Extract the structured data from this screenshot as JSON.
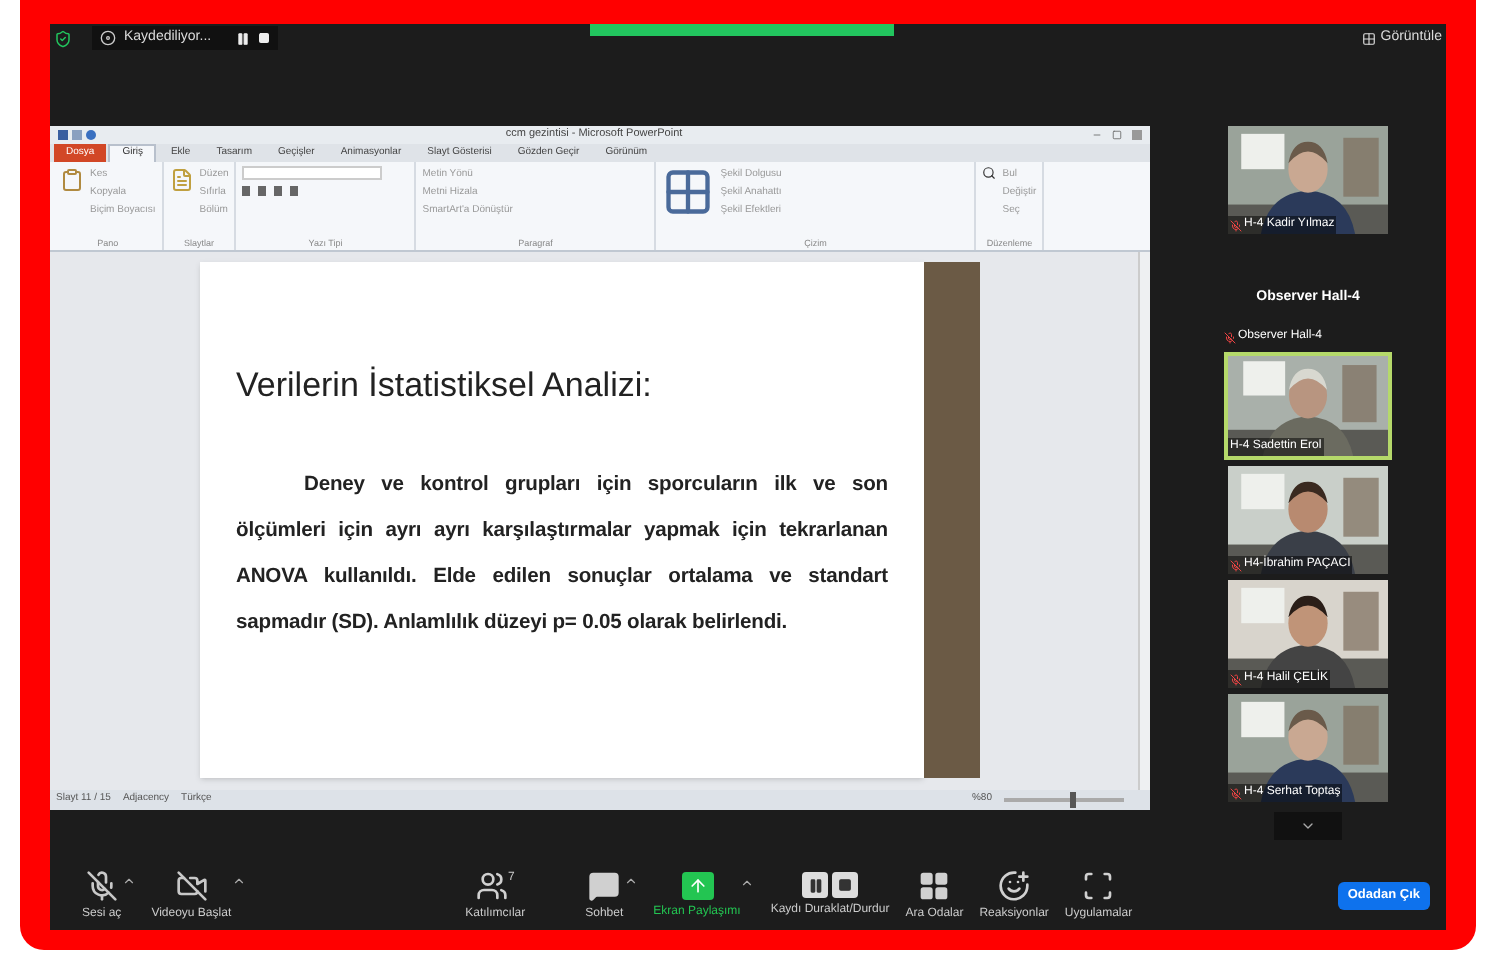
{
  "top_bar": {
    "recording_label": "Kaydediliyor...",
    "view_button": "Görüntüle"
  },
  "powerpoint": {
    "title": "ccm gezintisi - Microsoft PowerPoint",
    "tabs": [
      {
        "label": "Dosya",
        "selected": false,
        "kind": "file"
      },
      {
        "label": "Giriş",
        "selected": true,
        "kind": "tab"
      },
      {
        "label": "Ekle",
        "selected": false,
        "kind": "tab"
      },
      {
        "label": "Tasarım",
        "selected": false,
        "kind": "tab"
      },
      {
        "label": "Geçişler",
        "selected": false,
        "kind": "tab"
      },
      {
        "label": "Animasyonlar",
        "selected": false,
        "kind": "tab"
      },
      {
        "label": "Slayt Gösterisi",
        "selected": false,
        "kind": "tab"
      },
      {
        "label": "Gözden Geçir",
        "selected": false,
        "kind": "tab"
      },
      {
        "label": "Görünüm",
        "selected": false,
        "kind": "tab"
      }
    ],
    "ribbon_groups": [
      {
        "label": "Pano",
        "buttons": [
          "Kes",
          "Kopyala",
          "Biçim Boyacısı"
        ]
      },
      {
        "label": "Slaytlar",
        "buttons": [
          "Düzen",
          "Sıfırla",
          "Bölüm"
        ]
      },
      {
        "label": "Yazı Tipi"
      },
      {
        "label": "Paragraf",
        "buttons": [
          "Metin Yönü",
          "Metni Hizala",
          "SmartArt'a Dönüştür"
        ]
      },
      {
        "label": "Çizim",
        "buttons": [
          "Şekil Dolgusu",
          "Şekil Anahattı",
          "Şekil Efektleri"
        ]
      },
      {
        "label": "Düzenleme",
        "buttons": [
          "Bul",
          "Değiştir",
          "Seç"
        ]
      }
    ],
    "slide": {
      "title": "Verilerin İstatistiksel Analizi:",
      "paragraph": "Deney ve kontrol grupları için sporcuların ilk ve son ölçümleri için ayrı ayrı karşılaştırmalar yapmak için tekrarlanan ANOVA kullanıldı. Elde edilen sonuçlar ortalama ve standart sapmadır (SD). Anlamlılık düzeyi p= 0.05 olarak belirlendi."
    },
    "status_bar": [
      "Slayt 11 / 15",
      "Adjacency",
      "Türkçe"
    ],
    "zoom": {
      "reading": "%80",
      "level": 0.55
    }
  },
  "participants": [
    {
      "name": "H-4 Kadir Yılmaz",
      "kind": "video",
      "muted": true,
      "active": false
    },
    {
      "display_name": "Observer Hall-4",
      "name": "Observer Hall-4",
      "kind": "name_only",
      "muted": true
    },
    {
      "name": "H-4 Sadettin Erol",
      "kind": "video",
      "muted": false,
      "active": true
    },
    {
      "name": "H4-İbrahim PAÇACI",
      "kind": "video",
      "muted": true,
      "active": false
    },
    {
      "name": "H-4 Halil ÇELİK",
      "kind": "video",
      "muted": true,
      "active": false
    },
    {
      "name": "H-4 Serhat Toptaş",
      "kind": "video",
      "muted": true,
      "active": false
    }
  ],
  "toolbar": [
    {
      "label": "Sesi aç",
      "kind": "mic",
      "highlighted": false
    },
    {
      "label": "Videoyu Başlat",
      "kind": "video",
      "highlighted": false
    },
    {
      "label": "Katılımcılar",
      "kind": "participants",
      "highlighted": false,
      "count": "7"
    },
    {
      "label": "Sohbet",
      "kind": "chat",
      "highlighted": false
    },
    {
      "label": "Ekran Paylaşımı",
      "kind": "share",
      "highlighted": true
    },
    {
      "label": "Kaydı Duraklat/Durdur",
      "kind": "record",
      "highlighted": false
    },
    {
      "label": "Ara Odalar",
      "kind": "rooms",
      "highlighted": false
    },
    {
      "label": "Reaksiyonlar",
      "kind": "reactions",
      "highlighted": false
    },
    {
      "label": "Uygulamalar",
      "kind": "apps",
      "highlighted": false
    }
  ],
  "leave_button": "Odadan Çık"
}
